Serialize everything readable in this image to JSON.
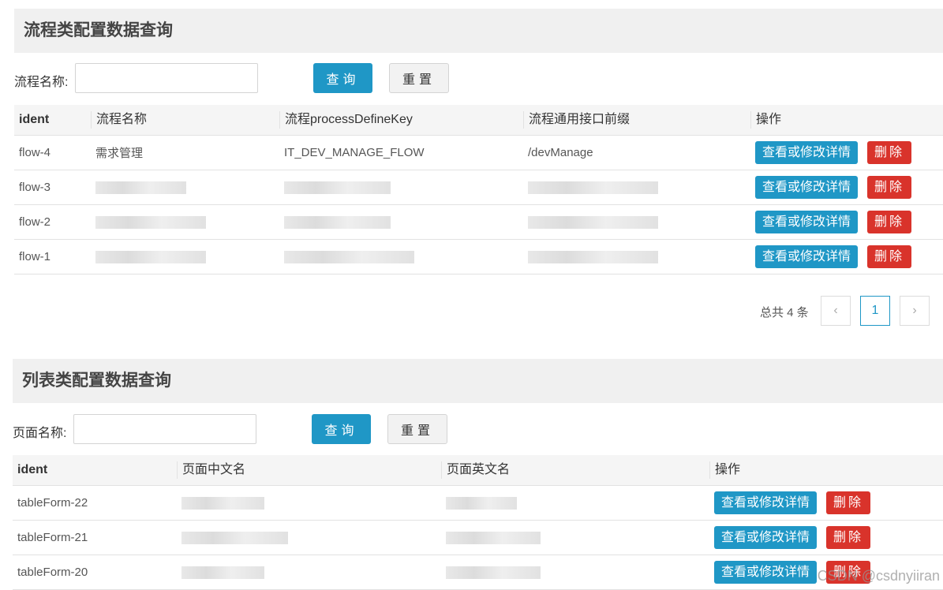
{
  "flow_panel": {
    "title": "流程类配置数据查询",
    "search_label": "流程名称:",
    "search_value": "",
    "query_label": "查询",
    "reset_label": "重置",
    "columns": [
      "ident",
      "流程名称",
      "流程processDefineKey",
      "流程通用接口前缀",
      "操作"
    ],
    "rows": [
      {
        "ident": "flow-4",
        "name": "需求管理",
        "key": "IT_DEV_MANAGE_FLOW",
        "prefix": "/devManage"
      },
      {
        "ident": "flow-3",
        "name": "",
        "key": "",
        "prefix": ""
      },
      {
        "ident": "flow-2",
        "name": "",
        "key": "",
        "prefix": ""
      },
      {
        "ident": "flow-1",
        "name": "",
        "key": "",
        "prefix": ""
      }
    ],
    "detail_label": "查看或修改详情",
    "delete_label": "删除",
    "pager": {
      "total_text": "总共 4 条",
      "prev_icon": "‹",
      "current_page": "1",
      "next_icon": "›"
    }
  },
  "list_panel": {
    "title": "列表类配置数据查询",
    "search_label": "页面名称:",
    "search_value": "",
    "query_label": "查询",
    "reset_label": "重置",
    "columns": [
      "ident",
      "页面中文名",
      "页面英文名",
      "操作"
    ],
    "rows": [
      {
        "ident": "tableForm-22",
        "cn_name": "",
        "en_name": ""
      },
      {
        "ident": "tableForm-21",
        "cn_name": "",
        "en_name": ""
      },
      {
        "ident": "tableForm-20",
        "cn_name": "",
        "en_name": ""
      }
    ],
    "detail_label": "查看或修改详情",
    "delete_label": "删除"
  },
  "watermark": "CSDN @csdnyiiran",
  "colors": {
    "primary": "#1f97c6",
    "danger": "#d9332b",
    "header_bg": "#f0f0f0"
  }
}
